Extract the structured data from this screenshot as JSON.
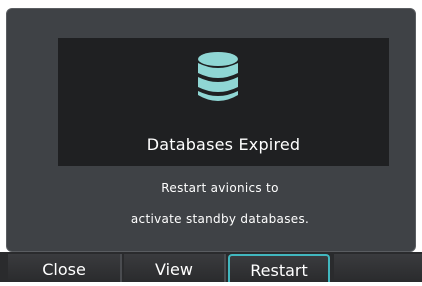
{
  "dialog": {
    "icon": "database-icon",
    "title": "Databases Expired",
    "message_line1": "Restart avionics to",
    "message_line2": "activate standby databases."
  },
  "softkeys": {
    "close": "Close",
    "view": "View",
    "restart": "Restart",
    "selected": "Restart"
  },
  "colors": {
    "accent": "#41b7bf",
    "icon": "#8fd6d4",
    "panel": "#3f4246",
    "dialog_bg": "#1f2022"
  }
}
